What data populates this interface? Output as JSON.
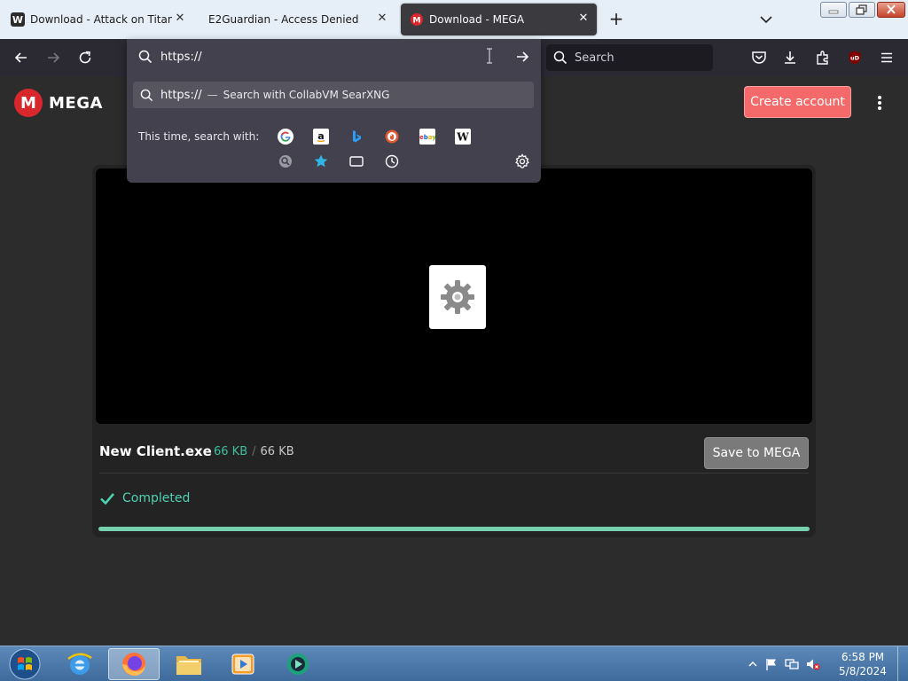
{
  "browser": {
    "tabs": [
      {
        "title": "Download -  Attack on Titan Te",
        "favicon": "w-logo-icon"
      },
      {
        "title": "E2Guardian - Access Denied",
        "favicon": ""
      },
      {
        "title": "Download - MEGA",
        "favicon": "mega-icon"
      }
    ],
    "search_placeholder": "Search"
  },
  "urlbar": {
    "value": "https://",
    "suggestion_query": "https://",
    "suggestion_separator": "—",
    "suggestion_action": "Search with CollabVM SearXNG",
    "search_with_label": "This time, search with:",
    "engines": [
      "google-icon",
      "amazon-icon",
      "bing-icon",
      "duckduckgo-icon",
      "ebay-icon",
      "wikipedia-icon",
      "searx-icon",
      "bookmarks-icon",
      "tabs-icon",
      "history-icon"
    ]
  },
  "page": {
    "logo_letter": "M",
    "logo_text": "MEGA",
    "create_account": "Create account",
    "file_name": "New Client.exe",
    "size_done": "66 KB",
    "size_sep": "/",
    "size_total": "66 KB",
    "save_button": "Save to MEGA",
    "status": "Completed",
    "progress": 1.0
  },
  "taskbar": {
    "time": "6:58 PM",
    "date": "5/8/2024"
  },
  "colors": {
    "accent_green": "#3fbf9f",
    "mega_red": "#d9272e",
    "create_btn": "#f46a6a"
  }
}
